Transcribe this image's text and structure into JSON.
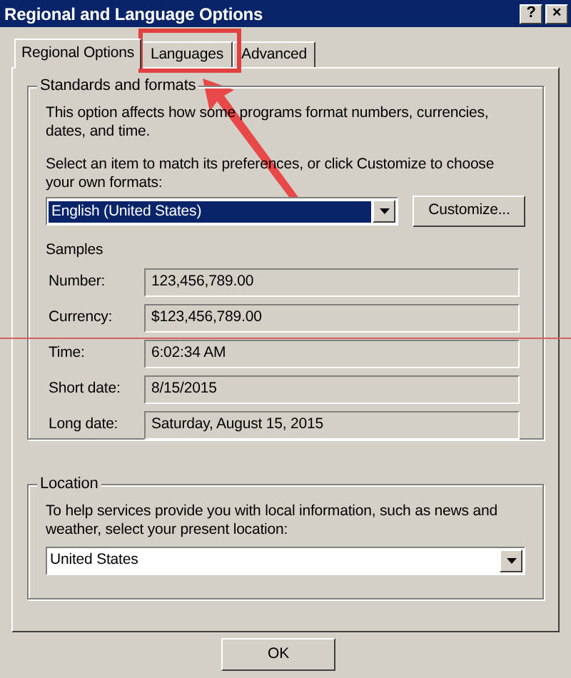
{
  "window": {
    "title": "Regional and Language Options",
    "title_buttons": [
      "?",
      "×"
    ]
  },
  "tabs": [
    {
      "label": "Regional Options",
      "selected": true
    },
    {
      "label": "Languages",
      "selected": false
    },
    {
      "label": "Advanced",
      "selected": false
    }
  ],
  "standards": {
    "legend": "Standards and formats",
    "description": "This option affects how some programs format numbers, currencies, dates, and time.",
    "prompt": "Select an item to match its preferences, or click Customize to choose your own formats:",
    "format": "English (United States)",
    "customize_button": "Customize...",
    "samples_heading": "Samples",
    "samples": [
      {
        "label": "Number:",
        "value": "123,456,789.00"
      },
      {
        "label": "Currency:",
        "value": "$123,456,789.00"
      },
      {
        "label": "Time:",
        "value": "6:02:34 AM"
      },
      {
        "label": "Short date:",
        "value": "8/15/2015"
      },
      {
        "label": "Long date:",
        "value": "Saturday, August 15, 2015"
      }
    ]
  },
  "location": {
    "legend": "Location",
    "description": "To help services provide you with local information, such as news and weather, select your present location:",
    "value": "United States"
  },
  "buttons": [
    "OK"
  ]
}
